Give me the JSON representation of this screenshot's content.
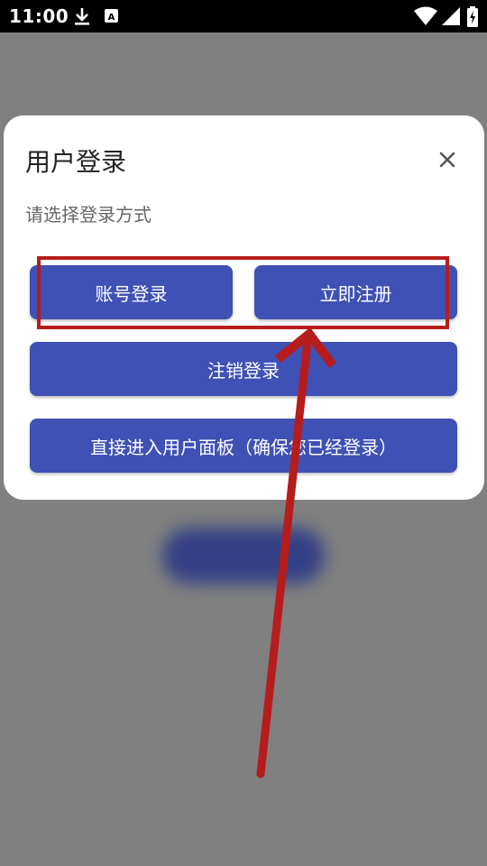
{
  "status_bar": {
    "time": "11:00",
    "icons": [
      "download-icon",
      "a-badge-icon",
      "wifi-icon",
      "signal-icon",
      "battery-charging-icon"
    ]
  },
  "dialog": {
    "title": "用户登录",
    "subtitle": "请选择登录方式",
    "close_icon": "close-icon",
    "buttons": {
      "account_login": "账号登录",
      "register": "立即注册",
      "logout": "注销登录",
      "enter_panel": "直接进入用户面板（确保您已经登录）"
    }
  },
  "colors": {
    "overlay": "#808080",
    "button": "#3f51b5",
    "annotation": "#b71c1c"
  }
}
